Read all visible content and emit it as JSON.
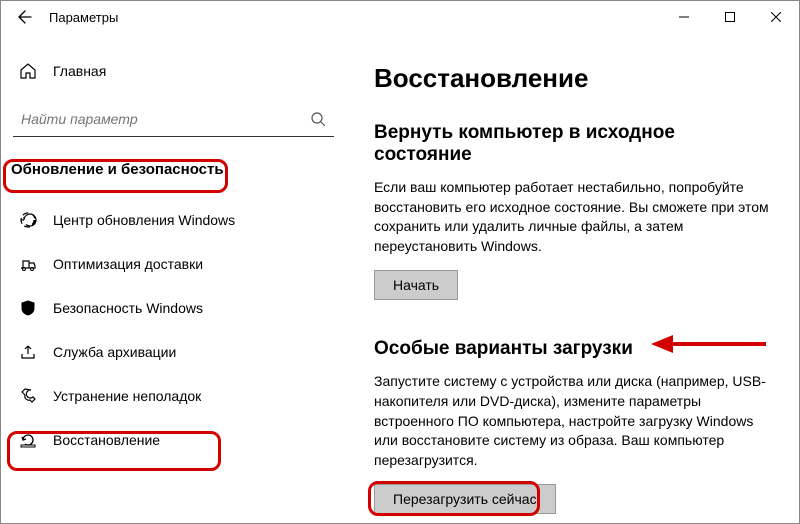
{
  "window": {
    "title": "Параметры"
  },
  "sidebar": {
    "home": "Главная",
    "search_placeholder": "Найти параметр",
    "category": "Обновление и безопасность",
    "items": [
      {
        "label": "Центр обновления Windows"
      },
      {
        "label": "Оптимизация доставки"
      },
      {
        "label": "Безопасность Windows"
      },
      {
        "label": "Служба архивации"
      },
      {
        "label": "Устранение неполадок"
      },
      {
        "label": "Восстановление"
      }
    ]
  },
  "main": {
    "title": "Восстановление",
    "section1": {
      "heading": "Вернуть компьютер в исходное состояние",
      "body": "Если ваш компьютер работает нестабильно, попробуйте восстановить его исходное состояние. Вы сможете при этом сохранить или удалить личные файлы, а затем переустановить Windows.",
      "button": "Начать"
    },
    "section2": {
      "heading": "Особые варианты загрузки",
      "body": "Запустите систему с устройства или диска (например, USB-накопителя или DVD-диска), измените параметры встроенного ПО компьютера, настройте загрузку Windows или восстановите систему из образа. Ваш компьютер перезагрузится.",
      "button": "Перезагрузить сейчас"
    }
  }
}
